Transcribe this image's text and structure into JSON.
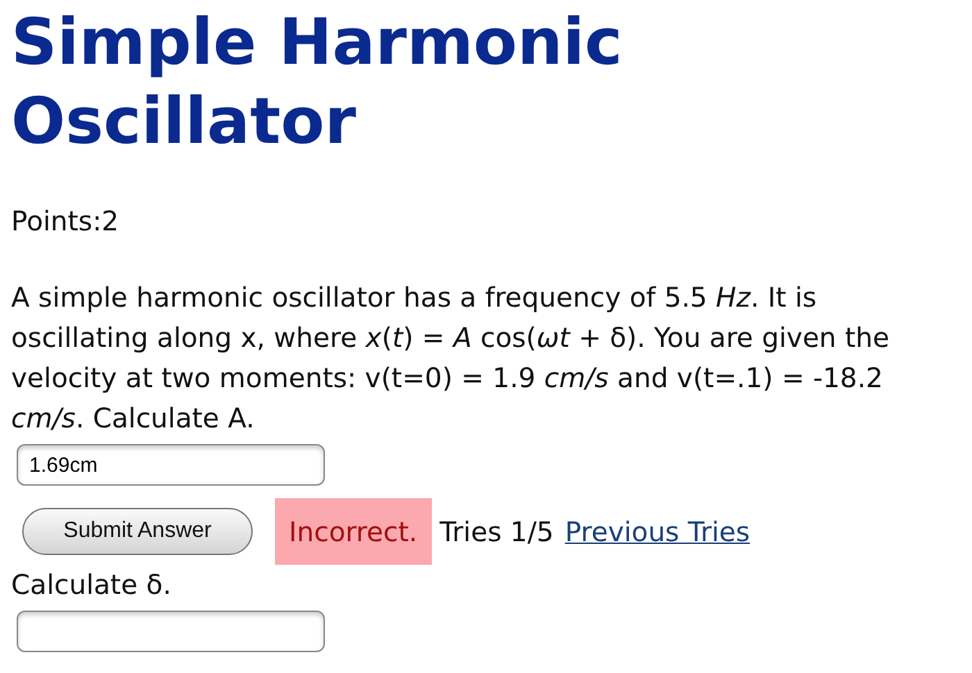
{
  "title": "Simple Harmonic Oscillator",
  "points": "Points:2",
  "questions": [
    {
      "prompt": "A simple harmonic oscillator has a frequency of 5.5 *Hz*. It is oscillating along x, where *x*(*t*) = *A* cos(*ωt* + δ). You are given the velocity at two moments: v(t=0) = 1.9 *cm/s* and v(t=.1) = -18.2 *cm/s*. Calculate A.",
      "answer": "1.69cm",
      "submit": "Submit Answer",
      "result": {
        "kind": "incorrect",
        "text": "Incorrect."
      },
      "tries": "Tries 1/5",
      "previous_link": "Previous Tries"
    },
    {
      "prompt": "Calculate δ."
    }
  ]
}
